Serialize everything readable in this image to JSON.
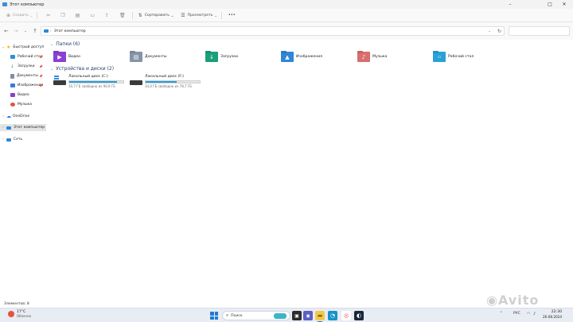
{
  "window": {
    "title": "Этот компьютер"
  },
  "commandbar": {
    "create_label": "Создать",
    "sort_label": "Сортировать",
    "view_label": "Просмотреть",
    "more_label": "•••"
  },
  "addressbar": {
    "path": "Этот компьютер",
    "search_placeholder": ""
  },
  "nav_pane": {
    "items": [
      {
        "label": "Быстрый доступ",
        "icon": "star-icon",
        "color": "#f2b300"
      },
      {
        "label": "Рабочий стол",
        "icon": "desktop-icon",
        "color": "#2f8ed8",
        "pinned": true
      },
      {
        "label": "Загрузки",
        "icon": "downloads-icon",
        "color": "#1c9c74",
        "pinned": true
      },
      {
        "label": "Документы",
        "icon": "documents-icon",
        "color": "#7f8fa6",
        "pinned": true
      },
      {
        "label": "Изображения",
        "icon": "pictures-icon",
        "color": "#3b7ad9",
        "pinned": true
      },
      {
        "label": "Видео",
        "icon": "video-icon",
        "color": "#8a40c9"
      },
      {
        "label": "Музыка",
        "icon": "music-icon",
        "color": "#e0524b"
      },
      {
        "label": "OneDrive",
        "icon": "cloud-icon",
        "color": "#1f78d1"
      },
      {
        "label": "Этот компьютер",
        "icon": "pc-icon",
        "color": "#2b88d8"
      },
      {
        "label": "Сеть",
        "icon": "network-icon",
        "color": "#2b88d8"
      }
    ],
    "pin_glyph": "📌"
  },
  "folders_section": {
    "title": "Папки (6)",
    "items": [
      {
        "label": "Видео",
        "icon": "video-folder-icon",
        "color": "#8b3fd6"
      },
      {
        "label": "Документы",
        "icon": "documents-folder-icon",
        "color": "#8794a8"
      },
      {
        "label": "Загрузки",
        "icon": "downloads-folder-icon",
        "color": "#19a07a"
      },
      {
        "label": "Изображения",
        "icon": "pictures-folder-icon",
        "color": "#2f86d6"
      },
      {
        "label": "Музыка",
        "icon": "music-folder-icon",
        "color": "#d86e6e"
      },
      {
        "label": "Рабочий стол",
        "icon": "desktop-folder-icon",
        "color": "#2ba0d8"
      }
    ]
  },
  "drives_section": {
    "title": "Устройства и диски (2)",
    "items": [
      {
        "label": "Локальный диск (C:)",
        "free": "10,7 ГБ свободно из 90,9 ГБ",
        "used_fraction": 0.88
      },
      {
        "label": "Локальный диск (F:)",
        "free": "34,0 ГБ свободно из 78,7 ГБ",
        "used_fraction": 0.57
      }
    ]
  },
  "statusbar": {
    "items_count": "Элементов: 8"
  },
  "taskbar": {
    "weather_temp": "17°C",
    "weather_condition": "Облачно",
    "search_label": "Поиск",
    "language": "РУС",
    "time": "22:30",
    "date": "26.08.2024",
    "accent": "#1f7ad4"
  },
  "watermark": {
    "text": "Avito"
  }
}
